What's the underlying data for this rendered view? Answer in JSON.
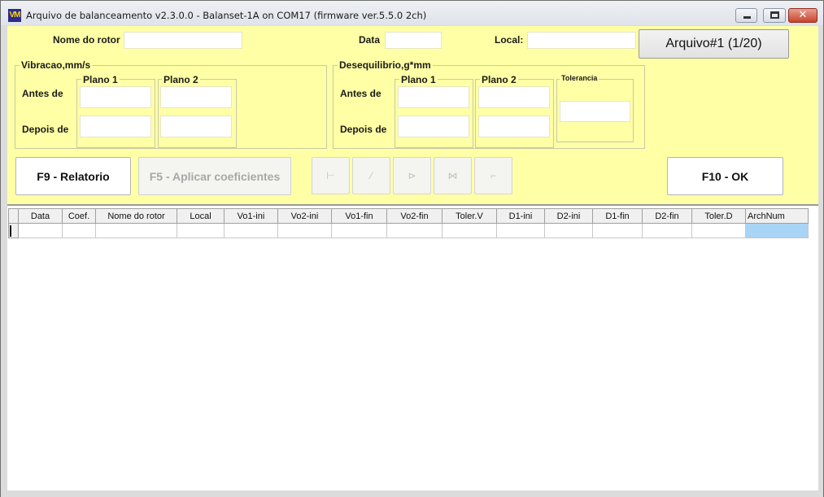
{
  "window": {
    "title": "Arquivo de balanceamento v2.3.0.0 - Balanset-1A on COM17 (firmware ver.5.5.0 2ch)",
    "icon": "VM",
    "controls": [
      "minimize-icon",
      "maximize-icon",
      "close-icon"
    ],
    "close_glyph": "✕"
  },
  "header": {
    "rotor_label": "Nome do rotor",
    "rotor_value": "",
    "date_label": "Data",
    "date_value": "",
    "local_label": "Local:",
    "local_value": "",
    "file_button": "Arquivo#1 (1/20)"
  },
  "vibration": {
    "title": "Vibracao,mm/s",
    "plane1": "Plano 1",
    "plane2": "Plano 2",
    "before": "Antes de",
    "after": "Depois de"
  },
  "imbalance": {
    "title": "Desequilibrio,g*mm",
    "plane1": "Plano 1",
    "plane2": "Plano 2",
    "tolerance": "Tolerancia",
    "before": "Antes de",
    "after": "Depois de"
  },
  "buttons": {
    "report": "F9 - Relatorio",
    "apply": "F5 - Aplicar coeficientes",
    "ok": "F10 - OK"
  },
  "toolbar_icons": [
    "nav-first-icon",
    "nav-prev-icon",
    "nav-next-icon",
    "nav-last-icon",
    "nav-refresh-icon"
  ],
  "toolbar_glyphs": [
    "⊢",
    "⁄",
    "⊳",
    "⋈",
    "⌐"
  ],
  "table": {
    "columns": [
      "Data",
      "Coef.",
      "Nome do rotor",
      "Local",
      "Vo1-ini",
      "Vo2-ini",
      "Vo1-fin",
      "Vo2-fin",
      "Toler.V",
      "D1-ini",
      "D2-ini",
      "D1-fin",
      "D2-fin",
      "Toler.D",
      "ArchNum"
    ],
    "rows": [
      [
        "",
        "",
        "",
        "",
        "",
        "",
        "",
        "",
        "",
        "",
        "",
        "",
        "",
        "",
        ""
      ]
    ]
  },
  "colors": {
    "panel": "#ffffa6",
    "selected_cell": "#a8d4f5"
  }
}
